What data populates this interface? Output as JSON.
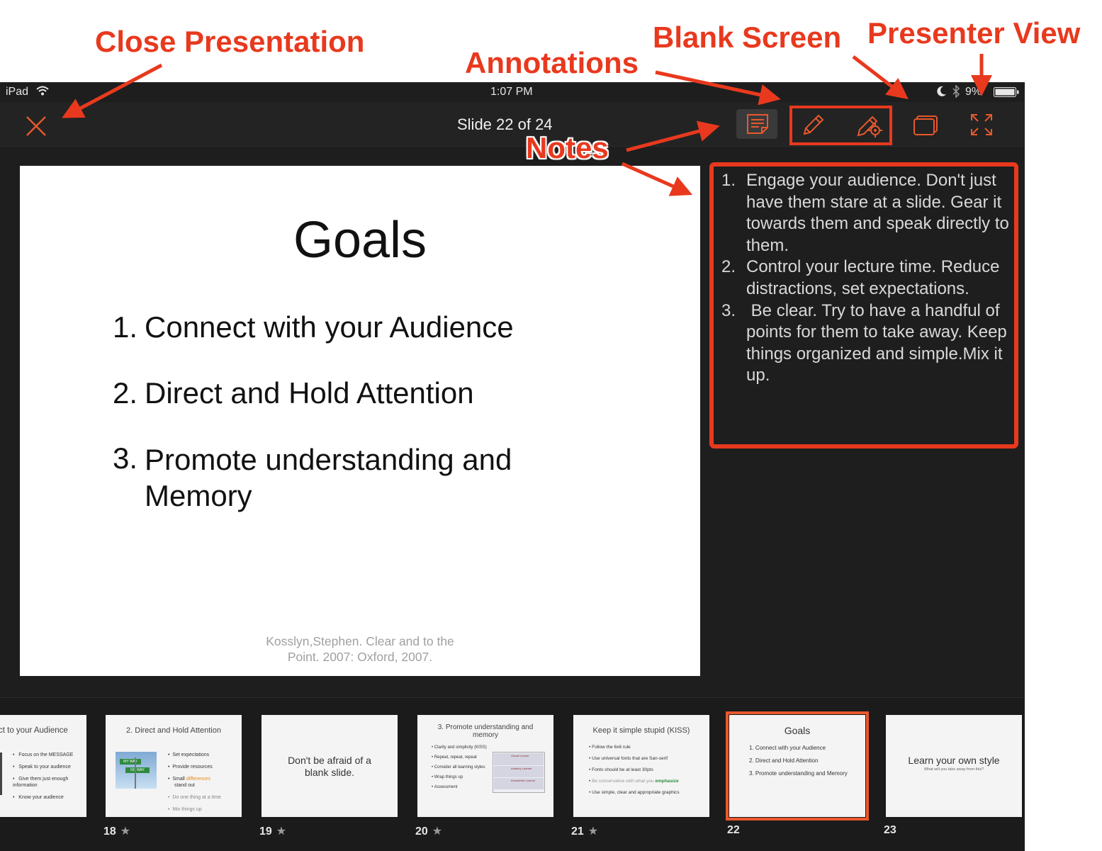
{
  "annotations": {
    "close_presentation": "Close Presentation",
    "annotations": "Annotations",
    "blank_screen": "Blank Screen",
    "presenter_view": "Presenter View",
    "notes": "Notes",
    "accent_color": "#e8391e"
  },
  "status_bar": {
    "device": "iPad",
    "time": "1:07 PM",
    "battery": "9",
    "battery_suffix": "%"
  },
  "toolbar": {
    "slide_counter": "Slide 22 of 24",
    "icons": [
      "close-icon",
      "notes-icon",
      "pencil-icon",
      "pencil-settings-icon",
      "blank-screen-icon",
      "presenter-view-icon"
    ]
  },
  "slide": {
    "title": "Goals",
    "items": [
      {
        "num": "1.",
        "text": "Connect with your Audience"
      },
      {
        "num": "2.",
        "text": "Direct and Hold Attention"
      },
      {
        "num": "3.",
        "text": "Promote understanding and Memory"
      }
    ],
    "citation_line1": "Kosslyn,Stephen. Clear and to the",
    "citation_line2": "Point. 2007: Oxford, 2007."
  },
  "notes": {
    "items": [
      {
        "num": "1.",
        "text": "Engage your audience. Don't just have them stare at a slide. Gear it towards them and speak directly to them."
      },
      {
        "num": "2.",
        "text": "Control your lecture time. Reduce distractions, set expectations."
      },
      {
        "num": "3.",
        "text": " Be clear. Try to have a handful of points for them to take away. Keep things organized and simple.Mix it up."
      }
    ]
  },
  "thumbnails": [
    {
      "title": "ct to your Audience",
      "bullets": [
        "Focus on the MESSAGE",
        "Speak to your audience",
        "Give them just enough information",
        "Know your audience"
      ]
    },
    {
      "number": "18",
      "title": "2. Direct and Hold Attention",
      "sign1": "MY WAY",
      "sign2": "NO WAY",
      "bullets": [
        "Set expectations",
        "Provide resources",
        "Small",
        "differences",
        "stand out",
        "Do one thing at a time",
        "Mix things up"
      ]
    },
    {
      "number": "19",
      "text": "Don't be afraid of a blank slide."
    },
    {
      "number": "20",
      "title": "3. Promote understanding and memory",
      "bullets": [
        "Clarity and simplicity (KISS)",
        "Repeat, repeat, repeat",
        "Consider all learning styles",
        "Wrap things up",
        "Assessment"
      ],
      "learner_labels": [
        "Visual Learner",
        "Auditory Learner",
        "Kinesthetic Learner"
      ]
    },
    {
      "number": "21",
      "title": "Keep it simple stupid (KISS)",
      "bullets": [
        "Follow the 6x6 rule",
        "Use universal fonts that are San-serif",
        "Fonts should be at least 30pts",
        "Be conservative with what you",
        "emphasize",
        "Use simple, clear and appropriate graphics"
      ]
    },
    {
      "number": "22",
      "title": "Goals",
      "items": [
        "1. Connect with your Audience",
        "2. Direct and Hold Attention",
        "3. Promote understanding and Memory"
      ]
    },
    {
      "number": "23",
      "title": "Learn your own style",
      "subtitle": "What will you take away from this?"
    }
  ]
}
